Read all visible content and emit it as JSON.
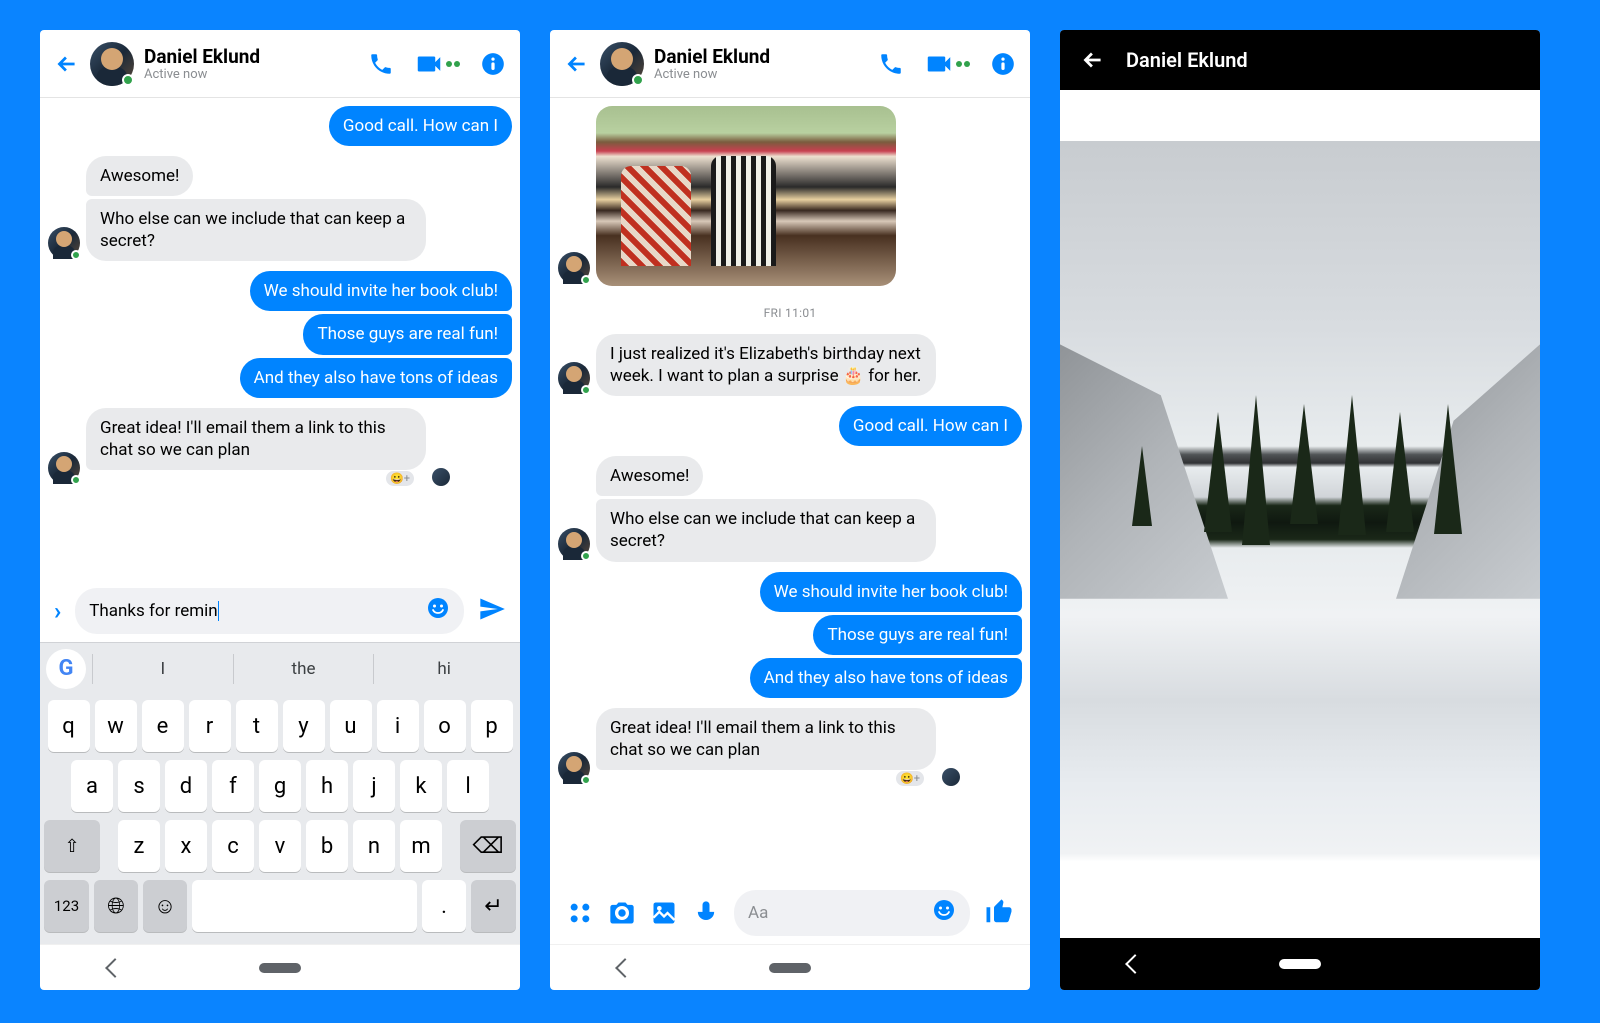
{
  "contact": {
    "name": "Daniel Eklund",
    "status": "Active now"
  },
  "screen1": {
    "messages": [
      {
        "side": "out",
        "texts": [
          "Good call. How can I"
        ]
      },
      {
        "side": "in",
        "texts": [
          "Awesome!",
          "Who else can we include that can keep a secret?"
        ]
      },
      {
        "side": "out",
        "texts": [
          "We should invite her book club!",
          "Those guys are real fun!",
          "And they also have tons of ideas"
        ]
      },
      {
        "side": "in",
        "texts": [
          "Great idea! I'll email them a link to this chat so we can plan"
        ],
        "react": "😀+"
      }
    ],
    "draft": "Thanks for remin",
    "suggestions": [
      "I",
      "the",
      "hi"
    ]
  },
  "screen2": {
    "timestamp": "FRI 11:01",
    "messages": [
      {
        "side": "in",
        "type": "photo"
      },
      {
        "side": "time"
      },
      {
        "side": "in",
        "texts": [
          "I just realized it's Elizabeth's birthday next week. I want to plan a surprise 🎂 for her."
        ]
      },
      {
        "side": "out",
        "texts": [
          "Good call. How can I"
        ]
      },
      {
        "side": "in",
        "texts": [
          "Awesome!",
          "Who else can we include that can keep a secret?"
        ]
      },
      {
        "side": "out",
        "texts": [
          "We should invite her book club!",
          "Those guys are real fun!",
          "And they also have tons of ideas"
        ]
      },
      {
        "side": "in",
        "texts": [
          "Great idea! I'll email them a link to this chat so we can plan"
        ],
        "react": "😀+",
        "seen": true
      }
    ],
    "placeholder": "Aa"
  },
  "keyboard": {
    "row1": [
      "q",
      "w",
      "e",
      "r",
      "t",
      "y",
      "u",
      "i",
      "o",
      "p"
    ],
    "row2": [
      "a",
      "s",
      "d",
      "f",
      "g",
      "h",
      "j",
      "k",
      "l"
    ],
    "row3": [
      "z",
      "x",
      "c",
      "v",
      "b",
      "n",
      "m"
    ],
    "sym": "123"
  }
}
